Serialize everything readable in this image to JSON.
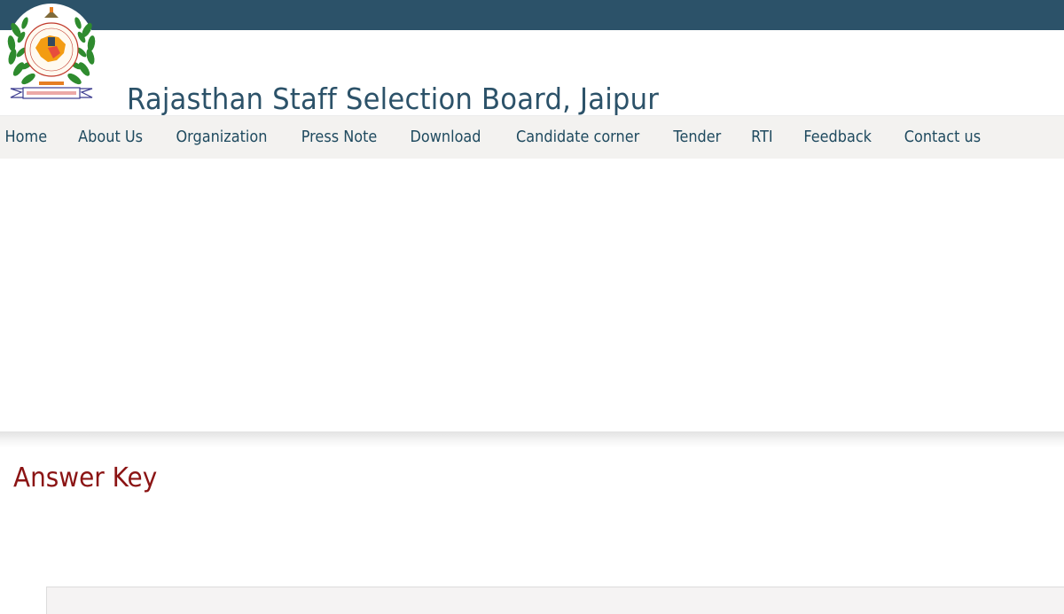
{
  "header": {
    "site_title": "Rajasthan Staff Selection Board, Jaipur",
    "logo_icon": "rssb-emblem-logo"
  },
  "nav": {
    "items": [
      {
        "label": "Home"
      },
      {
        "label": "About Us"
      },
      {
        "label": "Organization"
      },
      {
        "label": "Press Note"
      },
      {
        "label": "Download"
      },
      {
        "label": "Candidate corner"
      },
      {
        "label": "Tender"
      },
      {
        "label": "RTI"
      },
      {
        "label": "Feedback"
      },
      {
        "label": "Contact us"
      }
    ]
  },
  "main": {
    "heading": "Answer Key"
  },
  "colors": {
    "topbar": "#2c5269",
    "title": "#2c5269",
    "nav_bg": "#f3f2f0",
    "nav_text": "#1f4a5f",
    "heading": "#8b1414"
  }
}
